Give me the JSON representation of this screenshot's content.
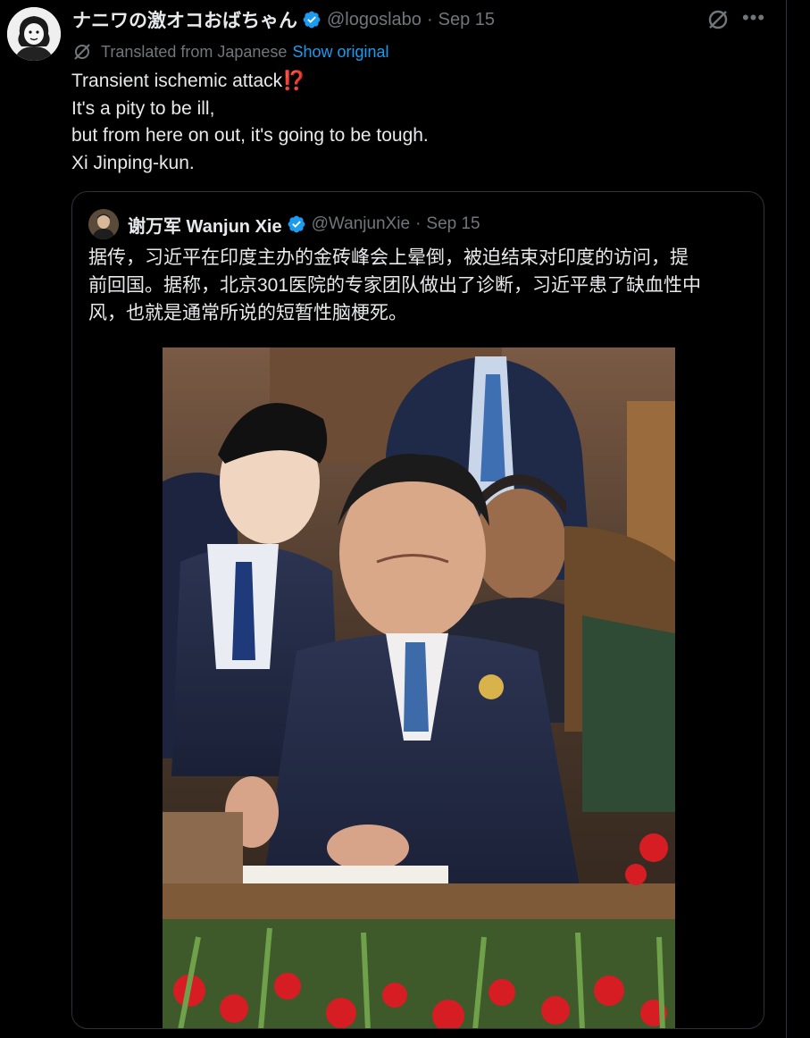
{
  "tweet": {
    "author": {
      "display_name": "ナニワの激オコおばちゃん",
      "handle": "@logoslabo",
      "date": "Sep 15"
    },
    "translation": {
      "label": "Translated from Japanese",
      "show_original": "Show original"
    },
    "lines": [
      "Transient ischemic attack",
      "It's a pity to be ill,",
      "but from here on out, it's going to be tough.",
      "Xi Jinping-kun."
    ],
    "emoji": "⁉️"
  },
  "quote": {
    "author": {
      "display_name": "谢万军 Wanjun Xie",
      "handle": "@WanjunXie",
      "date": "Sep 15"
    },
    "lines": [
      "据传，习近平在印度主办的金砖峰会上晕倒，被迫结束对印度的访问，提",
      "前回国。据称，北京301医院的专家团队做出了诊断，习近平患了缺血性中",
      "风，也就是通常所说的短暂性脑梗死。"
    ]
  },
  "colors": {
    "background": "#000000",
    "text": "#e7e9ea",
    "secondary": "#71767b",
    "link": "#1d9bf0",
    "verified": "#1d9bf0",
    "border": "#2f3336"
  },
  "icons": {
    "verified": "verified-badge-icon",
    "grok": "grok-icon",
    "more": "more-icon",
    "translate": "translate-icon"
  }
}
